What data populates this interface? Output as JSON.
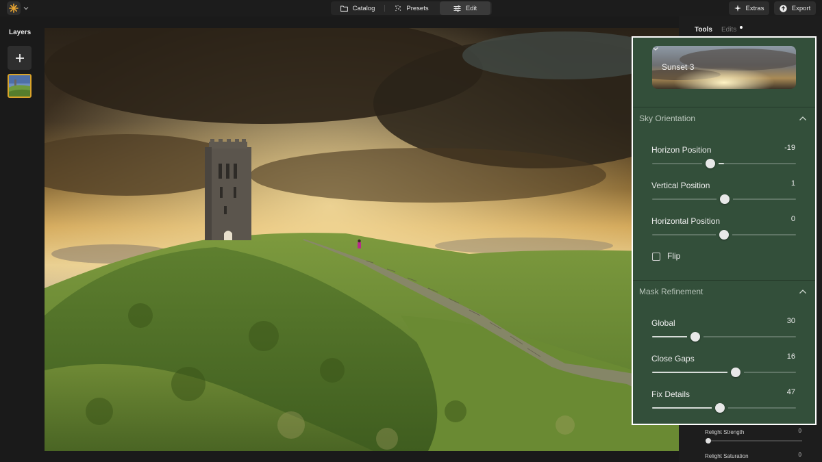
{
  "app": {
    "menu_icon": "sun-logo-icon",
    "accent": "#e8a532"
  },
  "modes": [
    {
      "label": "Catalog",
      "icon": "folder-icon",
      "active": false
    },
    {
      "label": "Presets",
      "icon": "sparkle-dots-icon",
      "active": false
    },
    {
      "label": "Edit",
      "icon": "sliders-icon",
      "active": true
    }
  ],
  "actions": {
    "extras_label": "Extras",
    "export_label": "Export"
  },
  "layers": {
    "title": "Layers"
  },
  "panel_tabs": {
    "tools_label": "Tools",
    "edits_label": "Edits"
  },
  "sky": {
    "selected": "Sunset 3"
  },
  "sky_orientation": {
    "title": "Sky Orientation",
    "sliders": [
      {
        "label": "Horizon Position",
        "value": "-19",
        "min": -100,
        "max": 100
      },
      {
        "label": "Vertical Position",
        "value": "1",
        "min": -100,
        "max": 100
      },
      {
        "label": "Horizontal Position",
        "value": "0",
        "min": -100,
        "max": 100
      }
    ],
    "flip_label": "Flip",
    "flip_checked": false
  },
  "mask_refinement": {
    "title": "Mask Refinement",
    "sliders": [
      {
        "label": "Global",
        "value": "30",
        "min": 0,
        "max": 100
      },
      {
        "label": "Close Gaps",
        "value": "16",
        "min": -100,
        "max": 100
      },
      {
        "label": "Fix Details",
        "value": "47",
        "min": 0,
        "max": 100
      }
    ]
  },
  "under_panel": [
    {
      "label": "Relight Strength",
      "value": "0"
    },
    {
      "label": "Relight Saturation",
      "value": "0"
    }
  ],
  "colors": {
    "panel_bg": "#334f3a",
    "highlight_border": "#ffffff",
    "layer_selected": "#d9a32a"
  }
}
